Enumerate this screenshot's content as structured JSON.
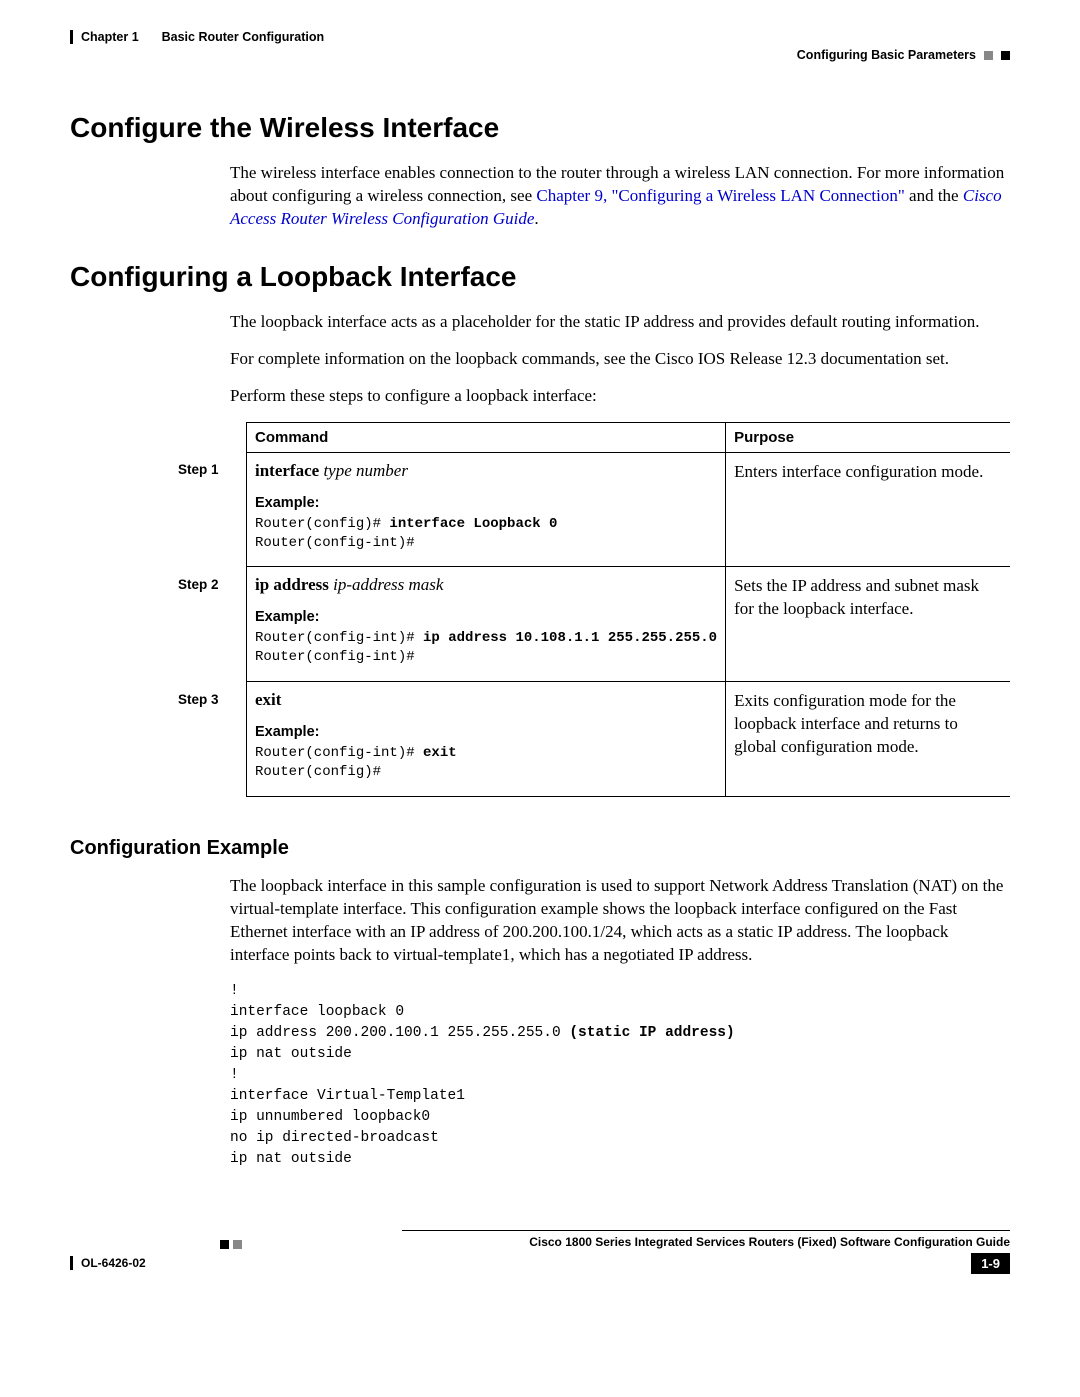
{
  "header": {
    "chapter": "Chapter 1",
    "chapter_title": "Basic Router Configuration",
    "subheader": "Configuring Basic Parameters"
  },
  "section1": {
    "title": "Configure the Wireless Interface",
    "para_pre": "The wireless interface enables connection to the router through a wireless LAN connection. For more information about configuring a wireless connection, see ",
    "link1": "Chapter 9, \"Configuring a Wireless LAN Connection\"",
    "mid": " and the ",
    "link2": "Cisco Access Router Wireless Configuration Guide",
    "end": "."
  },
  "section2": {
    "title": "Configuring a Loopback Interface",
    "para1": "The loopback interface acts as a placeholder for the static IP address and provides default routing information.",
    "para2": "For complete information on the loopback commands, see the Cisco IOS Release 12.3 documentation set.",
    "para3": "Perform these steps to configure a loopback interface:"
  },
  "table": {
    "head_command": "Command",
    "head_purpose": "Purpose",
    "example_label": "Example:",
    "steps": [
      {
        "step": "Step 1",
        "cmd_b": "interface",
        "cmd_i": " type number",
        "purpose": "Enters interface configuration mode.",
        "ex_line1_pre": "Router(config)# ",
        "ex_line1_b": "interface Loopback 0",
        "ex_line2": "Router(config-int)#"
      },
      {
        "step": "Step 2",
        "cmd_b": "ip address",
        "cmd_i": " ip-address mask",
        "purpose": "Sets the IP address and subnet mask for the loopback interface.",
        "ex_line1_pre": "Router(config-int)# ",
        "ex_line1_b": "ip address 10.108.1.1 255.255.255.0",
        "ex_line2": "Router(config-int)#"
      },
      {
        "step": "Step 3",
        "cmd_b": "exit",
        "cmd_i": "",
        "purpose": "Exits configuration mode for the loopback interface and returns to global configuration mode.",
        "ex_line1_pre": "Router(config-int)# ",
        "ex_line1_b": "exit",
        "ex_line2": "Router(config)#"
      }
    ]
  },
  "config_example": {
    "title": "Configuration Example",
    "para": "The loopback interface in this sample configuration is used to support Network Address Translation (NAT) on the virtual-template interface. This configuration example shows the loopback interface configured on the Fast Ethernet interface with an IP address of 200.200.100.1/24, which acts as a static IP address. The loopback interface points back to virtual-template1, which has a negotiated IP address.",
    "code_l1": "!",
    "code_l2": "interface loopback 0",
    "code_l3_pre": "ip address 200.200.100.1 255.255.255.0 ",
    "code_l3_b": "(static IP address)",
    "code_l4": "ip nat outside",
    "code_l5": "!",
    "code_l6": "interface Virtual-Template1",
    "code_l7": "ip unnumbered loopback0",
    "code_l8": "no ip directed-broadcast",
    "code_l9": "ip nat outside"
  },
  "footer": {
    "guide": "Cisco 1800 Series Integrated Services Routers (Fixed) Software Configuration Guide",
    "docid": "OL-6426-02",
    "page": "1-9"
  }
}
